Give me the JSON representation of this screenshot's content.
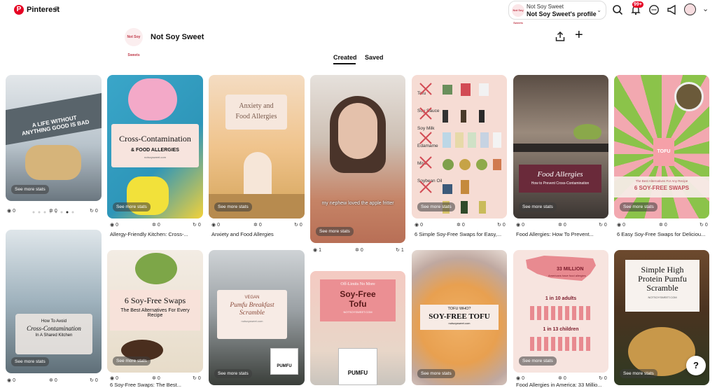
{
  "topbar": {
    "brand": "Pinterest",
    "menu_icon": "hamburger-icon",
    "account_switcher": {
      "line1": "Not Soy Sweet",
      "line2": "Not Soy Sweet's profile",
      "avatar_text": "Not Soy Sweets"
    },
    "notification_count": "99+"
  },
  "profile": {
    "name": "Not Soy Sweet",
    "avatar_text": "Not Soy Sweets",
    "tabs": [
      {
        "label": "Created",
        "active": true
      },
      {
        "label": "Saved",
        "active": false
      }
    ]
  },
  "pins_col1": [
    {
      "overlay": "A LIFE WITHOUT ANYTHING GOOD IS BAD",
      "see_more": "See more stats",
      "views": "0",
      "saves": "0",
      "outbound": "0",
      "bg": "#cfd8de"
    },
    {
      "overlay_title": "How To Avoid",
      "overlay_sub": "Cross-Contamination",
      "overlay_sub2": "In A Shared Kitchen",
      "site": "notsoysweet.com",
      "see_more": "See more stats",
      "views": "0",
      "saves": "0",
      "outbound": "0",
      "bg": "#9eb4c0"
    }
  ],
  "pins": [
    {
      "col": 2,
      "title1": "Cross-Contamination",
      "title2": "& FOOD ALLERGIES",
      "site": "notsoysweet.com",
      "see_more": "See more stats",
      "views": "0",
      "saves": "0",
      "outbound": "0",
      "caption": "Allergy-Friendly Kitchen: Cross-..."
    },
    {
      "col": 3,
      "title1": "Anxiety and",
      "title2": "Food Allergies",
      "see_more": "See more stats",
      "views": "0",
      "saves": "0",
      "outbound": "0",
      "caption": "Anxiety and Food Allergies"
    },
    {
      "col": 4,
      "subtitle": "my nephew loved the apple fritter",
      "see_more": "See more stats",
      "views": "1",
      "saves": "0",
      "outbound": "1"
    },
    {
      "col": 5,
      "items": [
        "Tofu",
        "Soy Sauce",
        "Soy Milk",
        "Edamame",
        "Miso",
        "Soybean Oil"
      ],
      "see_more": "See more stats",
      "views": "0",
      "saves": "0",
      "outbound": "0",
      "caption": "6 Simple Soy-Free Swaps for Easy,..."
    },
    {
      "col": 6,
      "title1": "Food Allergies",
      "title2": "How to Prevent Cross-Contamination",
      "see_more": "See more stats",
      "views": "0",
      "saves": "0",
      "outbound": "0",
      "caption": "Food Allergies: How To Prevent..."
    },
    {
      "col": 7,
      "label1": "TOFU",
      "banner1": "The Best Alternatives For Any Recipe",
      "banner2": "6 SOY-FREE SWAPS",
      "see_more": "See more stats",
      "views": "0",
      "saves": "0",
      "outbound": "0",
      "caption": "6 Easy Soy-Free Swaps for Deliciou..."
    }
  ],
  "pins_row2": [
    {
      "col": 2,
      "title1": "6 Soy-Free Swaps",
      "title2": "The Best Alternatives For Every Recipe",
      "see_more": "See more stats",
      "views": "0",
      "saves": "0",
      "outbound": "0",
      "caption": "6 Soy-Free Swaps: The Best..."
    },
    {
      "col": 3,
      "kicker": "VEGAN",
      "title1": "Pumfu Breakfast",
      "title2": "Scramble",
      "site": "notsoysweet.com",
      "brand": "PUMFU",
      "see_more": "See more stats"
    },
    {
      "col": 4,
      "kicker": "Off-Limits No More",
      "title1": "Soy-Free",
      "title2": "Tofu",
      "site": "NOTSOYSWEET.COM",
      "brand": "PUMFU"
    },
    {
      "col": 5,
      "kicker": "TOFU WHO?",
      "title1": "SOY-FREE TOFU",
      "site": "notsoysweet.com",
      "see_more": "See more stats"
    },
    {
      "col": 6,
      "stat1": "33 MILLION",
      "stat1_sub": "Americans have food allergies",
      "stat2": "1 in 10 adults",
      "stat3": "1 in 13 children",
      "see_more": "See more stats",
      "views": "0",
      "saves": "0",
      "outbound": "0",
      "caption": "Food Allergies in America: 33 Millio..."
    },
    {
      "col": 7,
      "title1": "Simple High",
      "title2": "Protein Pumfu",
      "title3": "Scramble",
      "site": "NOTSOYSWEET.COM",
      "see_more": "See more stats"
    }
  ],
  "help_label": "?",
  "colors": {
    "brand": "#e60023",
    "badge": "#e60023"
  }
}
